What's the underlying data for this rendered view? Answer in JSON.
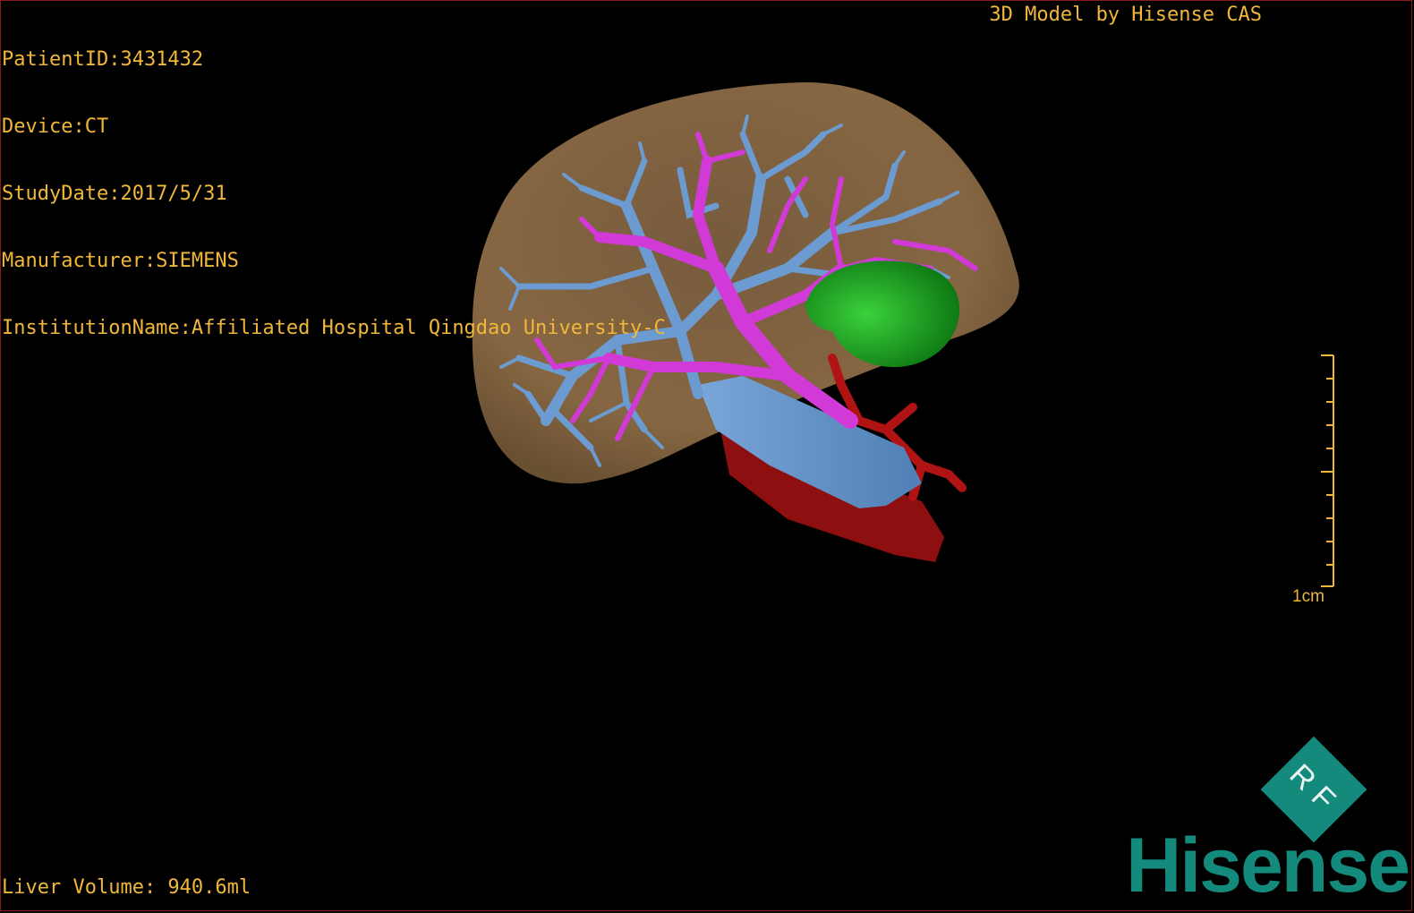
{
  "patient_info": {
    "patient_id": "PatientID:3431432",
    "device": "Device:CT",
    "study_date": "StudyDate:2017/5/31",
    "manufacturer": "Manufacturer:SIEMENS",
    "institution": "InstitutionName:Affiliated Hospital Qingdao University-C"
  },
  "credit": "3D Model by Hisense CAS",
  "liver_volume": "Liver Volume: 940.6ml",
  "scale_bar": {
    "label": "1cm"
  },
  "brand": {
    "badge_text": "RF",
    "name": "Hisense"
  },
  "colors": {
    "text": "#f0b73a",
    "liver": "#8a6a44",
    "portal_vein": "#d13ad6",
    "hepatic_vein": "#6b9bd1",
    "artery": "#b01313",
    "gallbladder": "#1fa82c",
    "brand": "#138a7c"
  }
}
